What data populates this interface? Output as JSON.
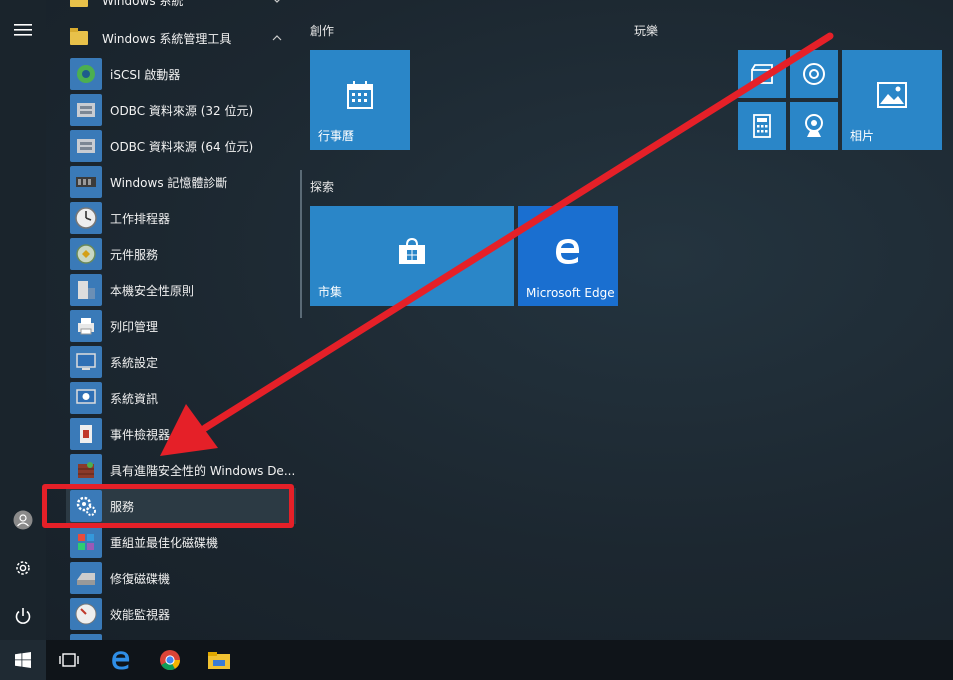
{
  "applist": {
    "top_partial": "Windows 系統",
    "group": "Windows 系統管理工具",
    "items": [
      {
        "label": "iSCSI 啟動器",
        "icon": "iscsi-icon"
      },
      {
        "label": "ODBC 資料來源 (32 位元)",
        "icon": "odbc-icon"
      },
      {
        "label": "ODBC 資料來源 (64 位元)",
        "icon": "odbc-icon"
      },
      {
        "label": "Windows 記憶體診斷",
        "icon": "memory-chip-icon"
      },
      {
        "label": "工作排程器",
        "icon": "clock-icon"
      },
      {
        "label": "元件服務",
        "icon": "component-services-icon"
      },
      {
        "label": "本機安全性原則",
        "icon": "security-policy-icon"
      },
      {
        "label": "列印管理",
        "icon": "printer-icon"
      },
      {
        "label": "系統設定",
        "icon": "system-config-icon"
      },
      {
        "label": "系統資訊",
        "icon": "system-info-icon"
      },
      {
        "label": "事件檢視器",
        "icon": "event-viewer-icon"
      },
      {
        "label": "具有進階安全性的 Windows De...",
        "icon": "firewall-icon"
      },
      {
        "label": "服務",
        "icon": "gear-services-icon"
      },
      {
        "label": "重組並最佳化磁碟機",
        "icon": "defrag-icon"
      },
      {
        "label": "修復磁碟機",
        "icon": "disk-icon"
      },
      {
        "label": "效能監視器",
        "icon": "performance-icon"
      }
    ]
  },
  "sections": {
    "create": "創作",
    "play": "玩樂",
    "explore": "探索"
  },
  "tiles": {
    "calendar": "行事曆",
    "photos": "相片",
    "store": "市集",
    "edge": "Microsoft Edge"
  },
  "colors": {
    "tile_blue": "#2a86c8",
    "edge_blue": "#1a6fd0",
    "highlight_red": "#e52028",
    "folder_yellow": "#e8c14a"
  }
}
